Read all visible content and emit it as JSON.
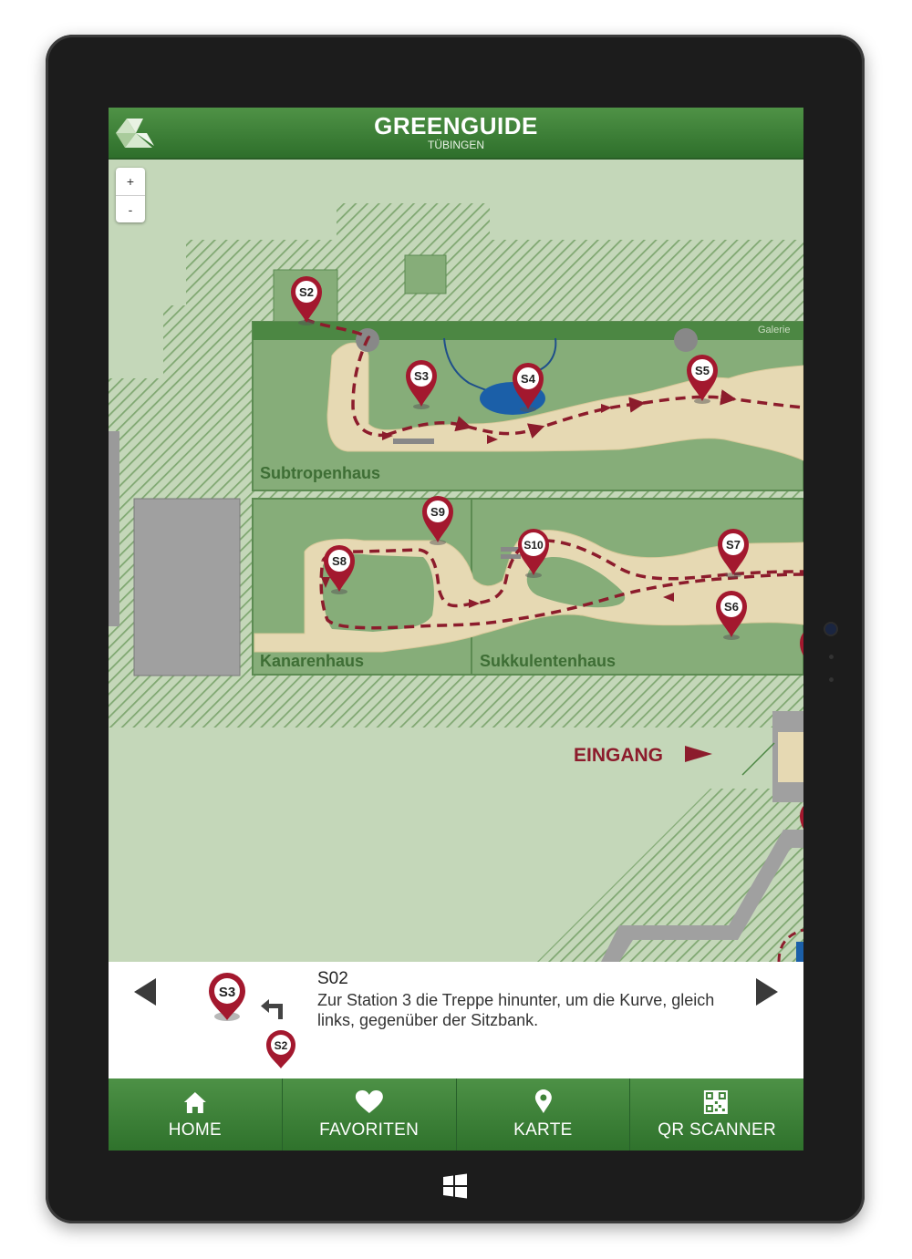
{
  "app": {
    "title": "GREENGUIDE",
    "subtitle": "TÜBINGEN"
  },
  "map": {
    "zoom_in": "+",
    "zoom_out": "-",
    "labels": {
      "galerie": "Galerie",
      "subtropenhaus": "Subtropenhaus",
      "kanarenhaus": "Kanarenhaus",
      "sukkulentenhaus": "Sukkulentenhaus",
      "eingang": "EINGANG"
    },
    "markers": {
      "s2": "S2",
      "s3": "S3",
      "s4": "S4",
      "s5": "S5",
      "s6": "S6",
      "s7": "S7",
      "s8": "S8",
      "s9": "S9",
      "s10": "S10"
    }
  },
  "station": {
    "id": "S02",
    "text": "Zur Station 3 die Treppe hinunter, um die Kurve, gleich links, gegenüber der Sitzbank.",
    "from_marker": "S2",
    "to_marker": "S3"
  },
  "nav": [
    {
      "label": "HOME",
      "icon": "home-icon"
    },
    {
      "label": "FAVORITEN",
      "icon": "heart-icon"
    },
    {
      "label": "KARTE",
      "icon": "map-pin-icon"
    },
    {
      "label": "QR SCANNER",
      "icon": "qr-code-icon"
    }
  ],
  "colors": {
    "header_green": "#3f8338",
    "map_background": "#c4d7b9",
    "greenhouse_green": "#86ad79",
    "path_sand": "#e6d9b3",
    "route_red": "#8c1c2c",
    "marker_red": "#a3182e"
  }
}
